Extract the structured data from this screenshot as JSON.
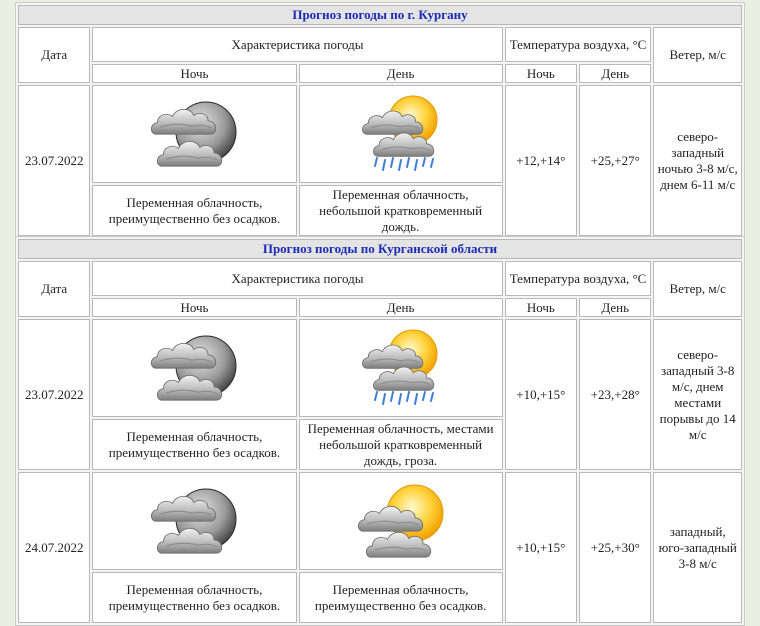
{
  "city_table": {
    "title": "Прогноз погоды по г. Кургану",
    "header": {
      "date": "Дата",
      "weather": "Характеристика погоды",
      "temp": "Температура воздуха, °C",
      "wind": "Ветер, м/с",
      "night": "Ночь",
      "day": "День",
      "t_night": "Ночь",
      "t_day": "День"
    },
    "rows": [
      {
        "date": "23.07.2022",
        "night_icon": "cloudy-moon-icon",
        "day_icon": "sun-cloud-rain-icon",
        "night_desc": "Переменная облачность, преимущественно без осадков.",
        "day_desc": "Переменная облачность, небольшой кратковременный дождь.",
        "t_night": "+12,+14°",
        "t_day": "+25,+27°",
        "wind": "северо-западный ночью 3-8 м/с, днем 6-11 м/с"
      }
    ]
  },
  "region_table": {
    "title": "Прогноз погоды по Курганской области",
    "header": {
      "date": "Дата",
      "weather": "Характеристика погоды",
      "temp": "Температура воздуха, °C",
      "wind": "Ветер, м/с",
      "night": "Ночь",
      "day": "День",
      "t_night": "Ночь",
      "t_day": "День"
    },
    "rows": [
      {
        "date": "23.07.2022",
        "night_icon": "cloudy-moon-icon",
        "day_icon": "sun-cloud-rain-icon",
        "night_desc": "Переменная облачность, преимущественно без осадков.",
        "day_desc": "Переменная облачность, местами небольшой кратковременный дождь, гроза.",
        "t_night": "+10,+15°",
        "t_day": "+23,+28°",
        "wind": "северо-западный 3-8 м/с, днем местами порывы до 14 м/с"
      },
      {
        "date": "24.07.2022",
        "night_icon": "cloudy-moon-icon",
        "day_icon": "sun-cloud-icon",
        "night_desc": "Переменная облачность, преимущественно без осадков.",
        "day_desc": "Переменная облачность, преимущественно без осадков.",
        "t_night": "+10,+15°",
        "t_day": "+25,+30°",
        "wind": "западный, юго-западный 3-8 м/с"
      }
    ]
  }
}
